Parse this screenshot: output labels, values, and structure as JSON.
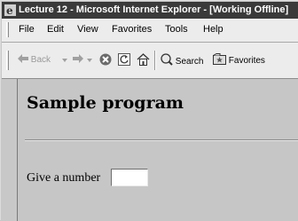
{
  "window": {
    "title": "Lecture 12 - Microsoft Internet Explorer - [Working Offline]"
  },
  "menu": {
    "items": [
      "File",
      "Edit",
      "View",
      "Favorites",
      "Tools",
      "Help"
    ]
  },
  "toolbar": {
    "back_label": "Back",
    "search_label": "Search",
    "favorites_label": "Favorites",
    "icons": [
      "back-arrow-icon",
      "dropdown-arrow-icon",
      "forward-arrow-icon",
      "stop-icon",
      "refresh-icon",
      "home-icon",
      "search-icon",
      "favorites-icon"
    ]
  },
  "page": {
    "heading": "Sample program",
    "prompt": "Give a number",
    "number_input_value": ""
  }
}
